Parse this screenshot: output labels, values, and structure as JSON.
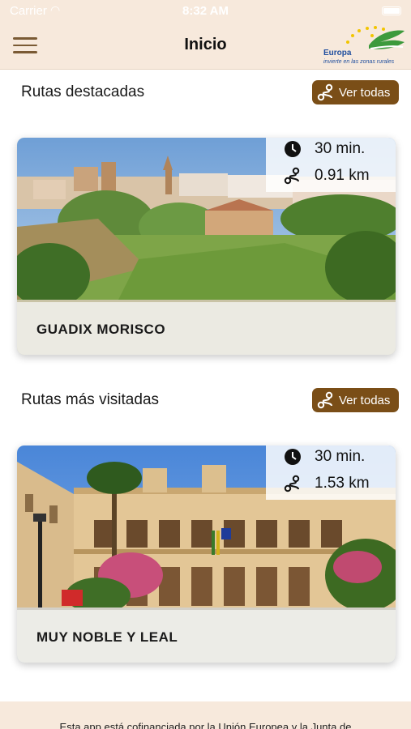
{
  "status_bar": {
    "carrier": "Carrier",
    "time": "8:32 AM"
  },
  "navbar": {
    "title": "Inicio",
    "logo": {
      "word": "Europa",
      "tagline": "invierte en las zonas rurales"
    }
  },
  "sections": [
    {
      "title": "Rutas destacadas",
      "button_label": "Ver todas",
      "card": {
        "name": "GUADIX MORISCO",
        "duration": "30 min.",
        "distance": "0.91 km"
      }
    },
    {
      "title": "Rutas más visitadas",
      "button_label": "Ver todas",
      "card": {
        "name": "MUY NOBLE Y LEAL",
        "duration": "30 min.",
        "distance": "1.53 km"
      }
    }
  ],
  "footer": {
    "text": "Esta app está cofinanciada por la Unión Europea y la Junta de"
  },
  "colors": {
    "header_bg": "#f7e9dc",
    "accent_brown": "#7a4e17",
    "eu_blue": "#1f4e9e",
    "eu_green": "#3c9a3c"
  },
  "icons": [
    "menu-icon",
    "clock-icon",
    "route-icon",
    "wifi-icon",
    "battery-icon"
  ]
}
